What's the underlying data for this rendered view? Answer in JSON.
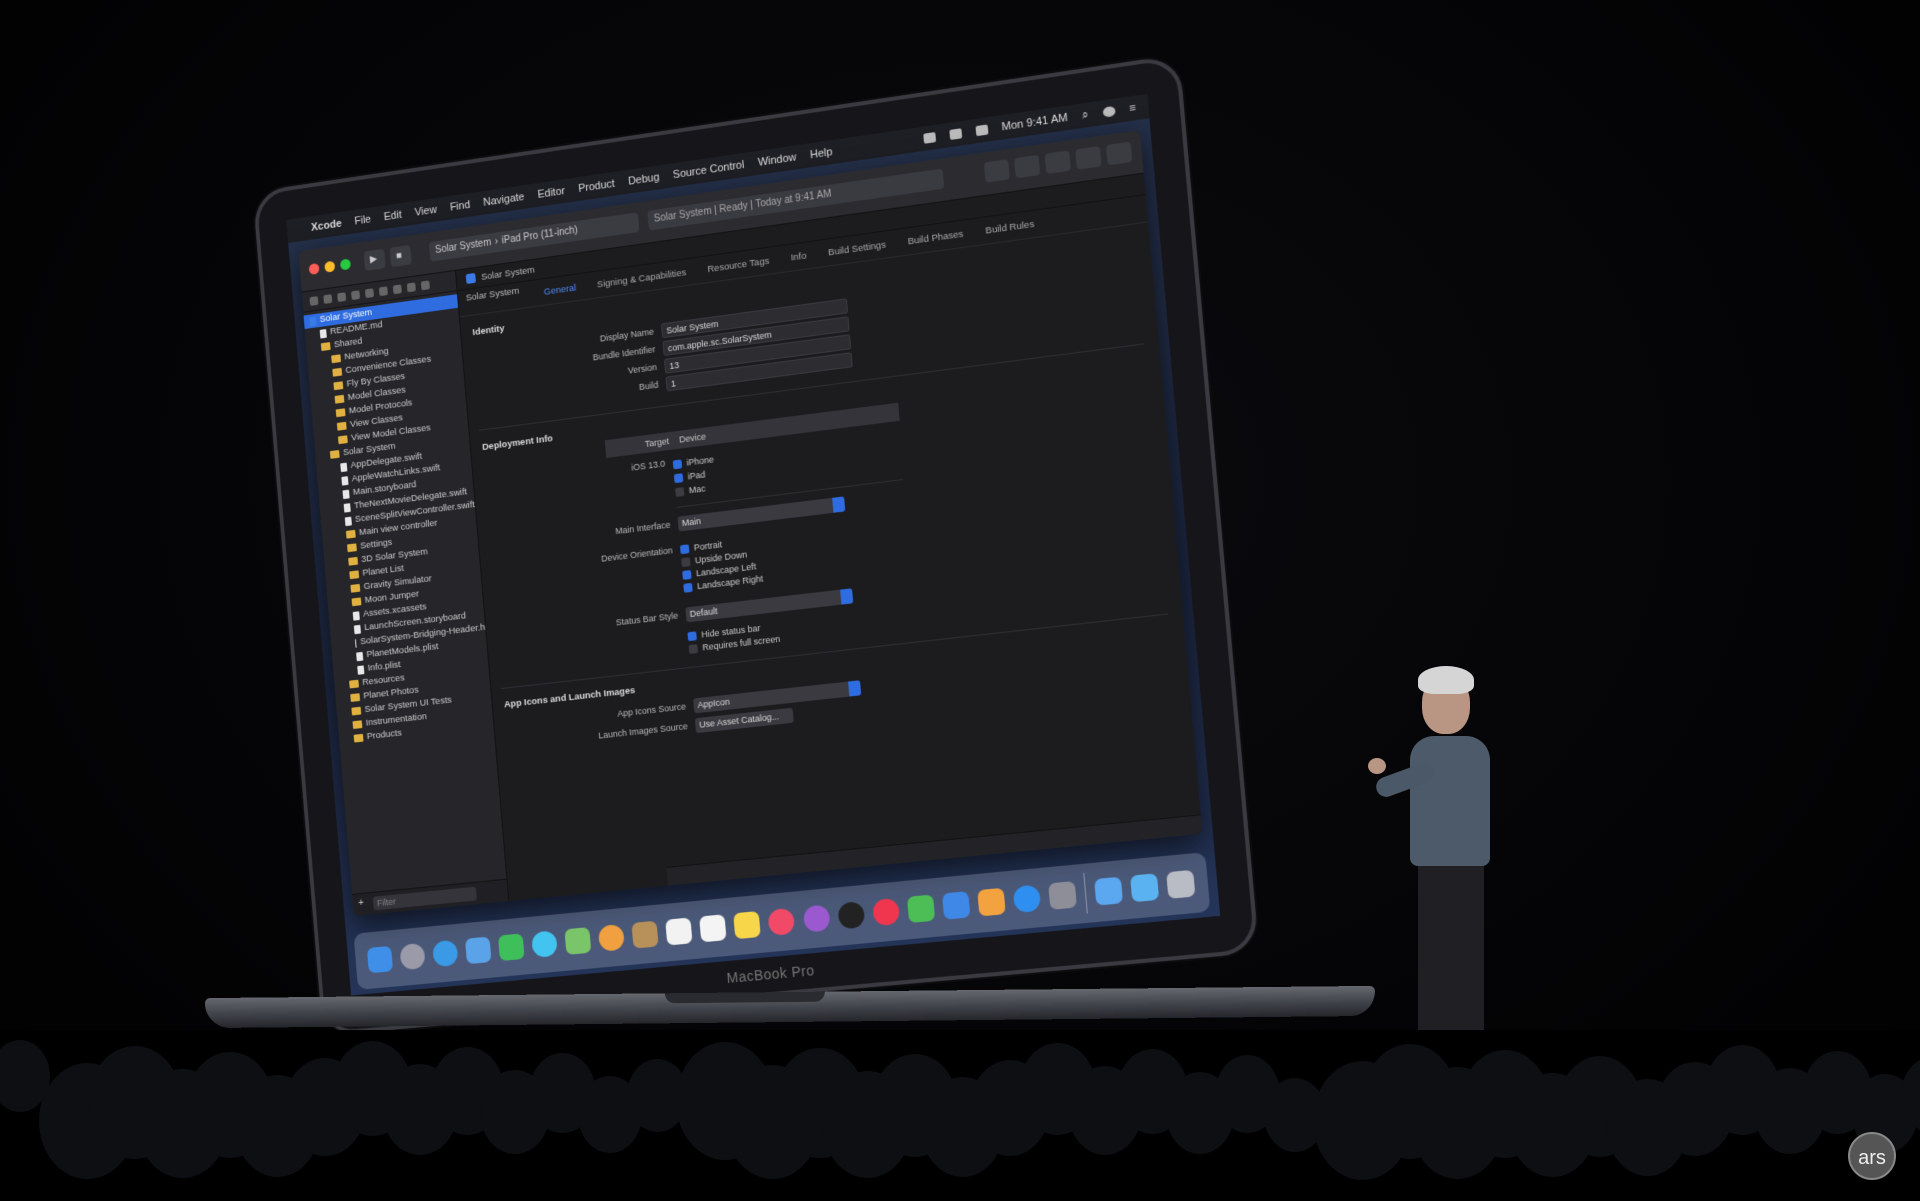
{
  "laptop": {
    "brand": "MacBook Pro"
  },
  "menubar": {
    "apple": "",
    "items": [
      "Xcode",
      "File",
      "Edit",
      "View",
      "Find",
      "Navigate",
      "Editor",
      "Product",
      "Debug",
      "Source Control",
      "Window",
      "Help"
    ],
    "clock": "Mon 9:41 AM"
  },
  "xcode": {
    "toolbar": {
      "scheme": "Solar System",
      "device": "iPad Pro (11-inch)",
      "activity": "Solar System | Ready | Today at 9:41 AM"
    },
    "jump_target": "Solar System",
    "target_menu": "Solar System",
    "tabs": [
      "General",
      "Signing & Capabilities",
      "Resource Tags",
      "Info",
      "Build Settings",
      "Build Phases",
      "Build Rules"
    ],
    "active_tab": "General",
    "navigator": [
      {
        "label": "Solar System",
        "kind": "project",
        "indent": 0,
        "selected": true
      },
      {
        "label": "README.md",
        "kind": "file",
        "indent": 1
      },
      {
        "label": "Shared",
        "kind": "folder",
        "indent": 1
      },
      {
        "label": "Networking",
        "kind": "folder",
        "indent": 2
      },
      {
        "label": "Convenience Classes",
        "kind": "folder",
        "indent": 2
      },
      {
        "label": "Fly By Classes",
        "kind": "folder",
        "indent": 2
      },
      {
        "label": "Model Classes",
        "kind": "folder",
        "indent": 2
      },
      {
        "label": "Model Protocols",
        "kind": "folder",
        "indent": 2
      },
      {
        "label": "View Classes",
        "kind": "folder",
        "indent": 2
      },
      {
        "label": "View Model Classes",
        "kind": "folder",
        "indent": 2
      },
      {
        "label": "Solar System",
        "kind": "folder",
        "indent": 1
      },
      {
        "label": "AppDelegate.swift",
        "kind": "file",
        "indent": 2
      },
      {
        "label": "AppleWatchLinks.swift",
        "kind": "file",
        "indent": 2
      },
      {
        "label": "Main.storyboard",
        "kind": "file",
        "indent": 2
      },
      {
        "label": "TheNextMovieDelegate.swift",
        "kind": "file",
        "indent": 2
      },
      {
        "label": "SceneSplitViewController.swift",
        "kind": "file",
        "indent": 2
      },
      {
        "label": "Main view controller",
        "kind": "folder",
        "indent": 2
      },
      {
        "label": "Settings",
        "kind": "folder",
        "indent": 2
      },
      {
        "label": "3D Solar System",
        "kind": "folder",
        "indent": 2
      },
      {
        "label": "Planet List",
        "kind": "folder",
        "indent": 2
      },
      {
        "label": "Gravity Simulator",
        "kind": "folder",
        "indent": 2
      },
      {
        "label": "Moon Jumper",
        "kind": "folder",
        "indent": 2
      },
      {
        "label": "Assets.xcassets",
        "kind": "file",
        "indent": 2
      },
      {
        "label": "LaunchScreen.storyboard",
        "kind": "file",
        "indent": 2
      },
      {
        "label": "SolarSystem-Bridging-Header.h",
        "kind": "file",
        "indent": 2
      },
      {
        "label": "PlanetModels.plist",
        "kind": "file",
        "indent": 2
      },
      {
        "label": "Info.plist",
        "kind": "file",
        "indent": 2
      },
      {
        "label": "Resources",
        "kind": "folder",
        "indent": 1
      },
      {
        "label": "Planet Photos",
        "kind": "folder",
        "indent": 1
      },
      {
        "label": "Solar System UI Tests",
        "kind": "folder",
        "indent": 1
      },
      {
        "label": "Instrumentation",
        "kind": "folder",
        "indent": 1
      },
      {
        "label": "Products",
        "kind": "folder",
        "indent": 1
      }
    ],
    "filter_placeholder": "Filter",
    "identity": {
      "title": "Identity",
      "display_name_label": "Display Name",
      "display_name": "Solar System",
      "bundle_id_label": "Bundle Identifier",
      "bundle_id": "com.apple.sc.SolarSystem",
      "version_label": "Version",
      "version": "13",
      "build_label": "Build",
      "build": "1"
    },
    "deployment": {
      "title": "Deployment Info",
      "target_label": "Target",
      "target_value": "Device",
      "ios_label": "iOS 13.0",
      "devices": [
        {
          "label": "iPhone",
          "checked": true
        },
        {
          "label": "iPad",
          "checked": true
        },
        {
          "label": "Mac",
          "checked": false
        }
      ],
      "main_interface_label": "Main Interface",
      "main_interface": "Main",
      "orientation_label": "Device Orientation",
      "orientations": [
        {
          "label": "Portrait",
          "checked": true
        },
        {
          "label": "Upside Down",
          "checked": false
        },
        {
          "label": "Landscape Left",
          "checked": true
        },
        {
          "label": "Landscape Right",
          "checked": true
        }
      ],
      "status_bar_label": "Status Bar Style",
      "status_bar": "Default",
      "status_options": [
        {
          "label": "Hide status bar",
          "checked": true
        },
        {
          "label": "Requires full screen",
          "checked": false
        }
      ]
    },
    "app_icons": {
      "title": "App Icons and Launch Images",
      "icons_source_label": "App Icons Source",
      "icons_source": "AppIcon",
      "launch_source_label": "Launch Images Source",
      "launch_source": "Use Asset Catalog..."
    }
  },
  "dock": {
    "apps": [
      {
        "name": "finder",
        "color": "#3f8fe8"
      },
      {
        "name": "launchpad",
        "color": "#9a9aa8",
        "round": true
      },
      {
        "name": "safari",
        "color": "#3a9ae6",
        "round": true
      },
      {
        "name": "mail",
        "color": "#5aa3e8"
      },
      {
        "name": "facetime",
        "color": "#3fbf5a"
      },
      {
        "name": "messages",
        "color": "#43c4f0",
        "round": true
      },
      {
        "name": "maps",
        "color": "#7ac46a"
      },
      {
        "name": "photos",
        "color": "#f0a040",
        "round": true
      },
      {
        "name": "contacts",
        "color": "#b7905a"
      },
      {
        "name": "calendar",
        "color": "#f2f2f2"
      },
      {
        "name": "reminders",
        "color": "#f4f4f4"
      },
      {
        "name": "notes",
        "color": "#f7d64a"
      },
      {
        "name": "music",
        "color": "#f04a68",
        "round": true
      },
      {
        "name": "podcasts",
        "color": "#9b59d0",
        "round": true
      },
      {
        "name": "tv",
        "color": "#222",
        "round": true
      },
      {
        "name": "news",
        "color": "#f0354f",
        "round": true
      },
      {
        "name": "numbers",
        "color": "#4cbe55"
      },
      {
        "name": "keynote",
        "color": "#3f88e8"
      },
      {
        "name": "pages",
        "color": "#f2a23e"
      },
      {
        "name": "app-store",
        "color": "#2f8ff0",
        "round": true
      },
      {
        "name": "system-preferences",
        "color": "#8e8e98"
      },
      {
        "name": "xcode",
        "color": "#5ba7f0"
      },
      {
        "name": "downloads-folder",
        "color": "#5ab3f0"
      },
      {
        "name": "trash",
        "color": "#b9bcc4"
      }
    ]
  },
  "watermark": {
    "text": "ars"
  }
}
